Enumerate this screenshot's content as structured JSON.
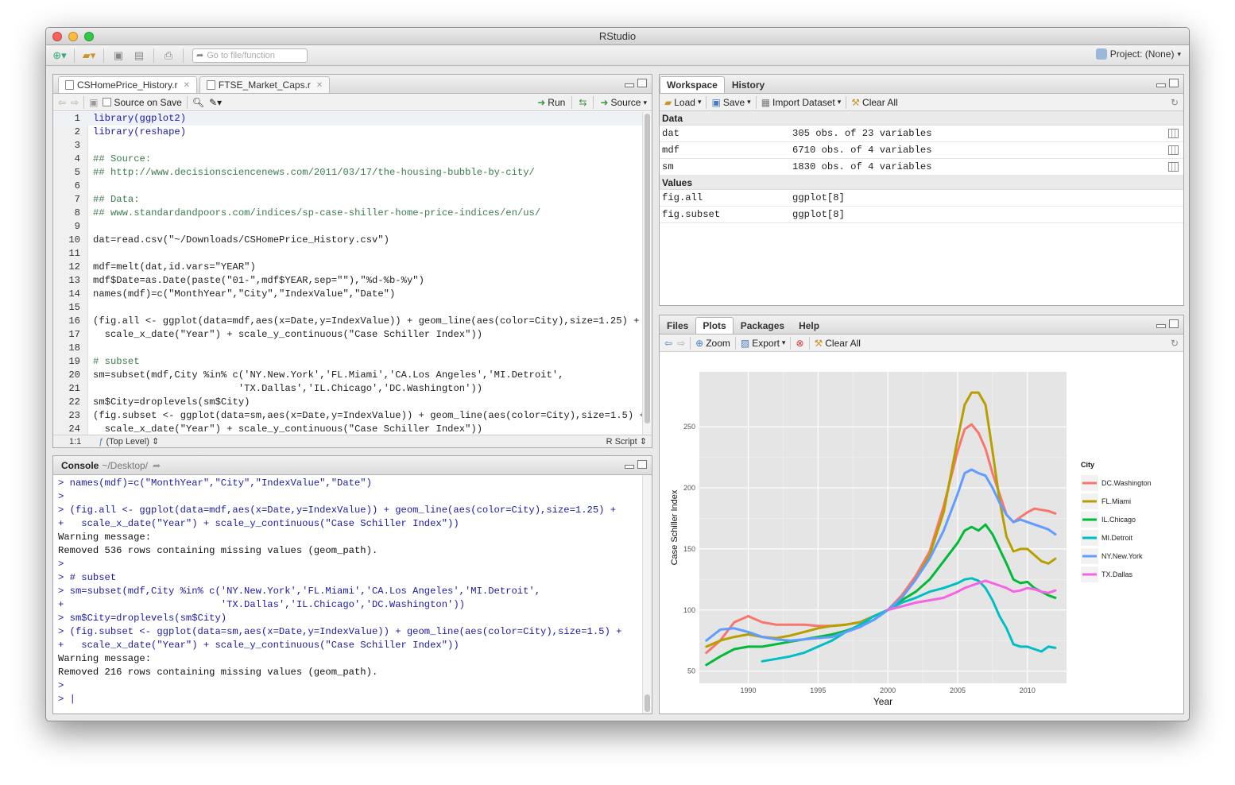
{
  "app": {
    "title": "RStudio",
    "goto_placeholder": "Go to file/function",
    "project": "Project: (None)"
  },
  "editor": {
    "tabs": [
      {
        "label": "CSHomePrice_History.r"
      },
      {
        "label": "FTSE_Market_Caps.r"
      }
    ],
    "source_on_save": "Source on Save",
    "run": "Run",
    "source": "Source",
    "lines": [
      {
        "n": "1",
        "t": "library(ggplot2)",
        "c": "kw"
      },
      {
        "n": "2",
        "t": "library(reshape)",
        "c": "kw"
      },
      {
        "n": "3",
        "t": "",
        "c": ""
      },
      {
        "n": "4",
        "t": "## Source:",
        "c": "cm"
      },
      {
        "n": "5",
        "t": "## http://www.decisionsciencenews.com/2011/03/17/the-housing-bubble-by-city/",
        "c": "cm"
      },
      {
        "n": "6",
        "t": "",
        "c": ""
      },
      {
        "n": "7",
        "t": "## Data:",
        "c": "cm"
      },
      {
        "n": "8",
        "t": "## www.standardandpoors.com/indices/sp-case-shiller-home-price-indices/en/us/",
        "c": "cm"
      },
      {
        "n": "9",
        "t": "",
        "c": ""
      },
      {
        "n": "10",
        "t": "dat=read.csv(\"~/Downloads/CSHomePrice_History.csv\")",
        "c": ""
      },
      {
        "n": "11",
        "t": "",
        "c": ""
      },
      {
        "n": "12",
        "t": "mdf=melt(dat,id.vars=\"YEAR\")",
        "c": ""
      },
      {
        "n": "13",
        "t": "mdf$Date=as.Date(paste(\"01-\",mdf$YEAR,sep=\"\"),\"%d-%b-%y\")",
        "c": ""
      },
      {
        "n": "14",
        "t": "names(mdf)=c(\"MonthYear\",\"City\",\"IndexValue\",\"Date\")",
        "c": ""
      },
      {
        "n": "15",
        "t": "",
        "c": ""
      },
      {
        "n": "16",
        "t": "(fig.all <- ggplot(data=mdf,aes(x=Date,y=IndexValue)) + geom_line(aes(color=City),size=1.25) +",
        "c": ""
      },
      {
        "n": "17",
        "t": "  scale_x_date(\"Year\") + scale_y_continuous(\"Case Schiller Index\"))",
        "c": ""
      },
      {
        "n": "18",
        "t": "",
        "c": ""
      },
      {
        "n": "19",
        "t": "# subset",
        "c": "cm"
      },
      {
        "n": "20",
        "t": "sm=subset(mdf,City %in% c('NY.New.York','FL.Miami','CA.Los Angeles','MI.Detroit',",
        "c": ""
      },
      {
        "n": "21",
        "t": "                         'TX.Dallas','IL.Chicago','DC.Washington'))",
        "c": ""
      },
      {
        "n": "22",
        "t": "sm$City=droplevels(sm$City)",
        "c": ""
      },
      {
        "n": "23",
        "t": "(fig.subset <- ggplot(data=sm,aes(x=Date,y=IndexValue)) + geom_line(aes(color=City),size=1.5) +",
        "c": ""
      },
      {
        "n": "24",
        "t": "  scale_x_date(\"Year\") + scale_y_continuous(\"Case Schiller Index\"))",
        "c": ""
      }
    ],
    "status_pos": "1:1",
    "status_scope": "(Top Level)",
    "status_type": "R Script"
  },
  "console": {
    "title": "Console",
    "path": "~/Desktop/",
    "lines": [
      {
        "t": "> names(mdf)=c(\"MonthYear\",\"City\",\"IndexValue\",\"Date\")",
        "c": "in"
      },
      {
        "t": ">",
        "c": "in"
      },
      {
        "t": "> (fig.all <- ggplot(data=mdf,aes(x=Date,y=IndexValue)) + geom_line(aes(color=City),size=1.25) +",
        "c": "in"
      },
      {
        "t": "+   scale_x_date(\"Year\") + scale_y_continuous(\"Case Schiller Index\"))",
        "c": "in"
      },
      {
        "t": "Warning message:",
        "c": "out"
      },
      {
        "t": "Removed 536 rows containing missing values (geom_path).",
        "c": "out"
      },
      {
        "t": ">",
        "c": "in"
      },
      {
        "t": "> # subset",
        "c": "in"
      },
      {
        "t": "> sm=subset(mdf,City %in% c('NY.New.York','FL.Miami','CA.Los Angeles','MI.Detroit',",
        "c": "in"
      },
      {
        "t": "+                           'TX.Dallas','IL.Chicago','DC.Washington'))",
        "c": "in"
      },
      {
        "t": "> sm$City=droplevels(sm$City)",
        "c": "in"
      },
      {
        "t": "> (fig.subset <- ggplot(data=sm,aes(x=Date,y=IndexValue)) + geom_line(aes(color=City),size=1.5) +",
        "c": "in"
      },
      {
        "t": "+   scale_x_date(\"Year\") + scale_y_continuous(\"Case Schiller Index\"))",
        "c": "in"
      },
      {
        "t": "Warning message:",
        "c": "out"
      },
      {
        "t": "Removed 216 rows containing missing values (geom_path).",
        "c": "out"
      },
      {
        "t": ">",
        "c": "in"
      },
      {
        "t": "> |",
        "c": "in"
      }
    ]
  },
  "workspace": {
    "tabs": [
      {
        "label": "Workspace"
      },
      {
        "label": "History"
      }
    ],
    "load": "Load",
    "save": "Save",
    "import": "Import Dataset",
    "clear": "Clear All",
    "data_header": "Data",
    "data": [
      {
        "name": "dat",
        "value": "305 obs. of 23 variables"
      },
      {
        "name": "mdf",
        "value": "6710 obs. of 4 variables"
      },
      {
        "name": "sm",
        "value": "1830 obs. of 4 variables"
      }
    ],
    "values_header": "Values",
    "values": [
      {
        "name": "fig.all",
        "value": "ggplot[8]"
      },
      {
        "name": "fig.subset",
        "value": "ggplot[8]"
      }
    ]
  },
  "files": {
    "tabs": [
      {
        "label": "Files"
      },
      {
        "label": "Plots"
      },
      {
        "label": "Packages"
      },
      {
        "label": "Help"
      }
    ],
    "zoom": "Zoom",
    "export": "Export",
    "clear": "Clear All"
  },
  "chart_data": {
    "type": "line",
    "title": "",
    "xlabel": "Year",
    "ylabel": "Case Schiller Index",
    "xlim": [
      1986.5,
      2012.8
    ],
    "ylim": [
      40,
      295
    ],
    "xticks": [
      "1990",
      "1995",
      "2000",
      "2005",
      "2010"
    ],
    "xtick_values": [
      1990,
      1995,
      2000,
      2005,
      2010
    ],
    "yticks": [
      "50",
      "100",
      "150",
      "200",
      "250"
    ],
    "ytick_values": [
      50,
      100,
      150,
      200,
      250
    ],
    "legend_title": "City",
    "legend_position": "right",
    "grid": true,
    "series": [
      {
        "name": "DC.Washington",
        "color": "#f8766d",
        "x": [
          1987,
          1988,
          1989,
          1990,
          1991,
          1992,
          1993,
          1994,
          1995,
          1996,
          1997,
          1998,
          1999,
          2000,
          2001,
          2002,
          2003,
          2004,
          2005,
          2005.5,
          2006,
          2006.5,
          2007,
          2007.5,
          2008,
          2008.5,
          2009,
          2009.5,
          2010,
          2010.5,
          2011,
          2011.5,
          2012
        ],
        "y": [
          65,
          75,
          90,
          95,
          90,
          88,
          88,
          88,
          87,
          87,
          88,
          90,
          95,
          100,
          112,
          128,
          148,
          185,
          230,
          248,
          252,
          245,
          232,
          212,
          195,
          178,
          172,
          176,
          180,
          183,
          182,
          181,
          179
        ]
      },
      {
        "name": "FL.Miami",
        "color": "#b79f00",
        "x": [
          1987,
          1988,
          1989,
          1990,
          1991,
          1992,
          1993,
          1994,
          1995,
          1996,
          1997,
          1998,
          1999,
          2000,
          2001,
          2002,
          2003,
          2004,
          2005,
          2005.5,
          2006,
          2006.5,
          2007,
          2007.5,
          2008,
          2008.5,
          2009,
          2009.5,
          2010,
          2010.5,
          2011,
          2011.5,
          2012
        ],
        "y": [
          70,
          75,
          78,
          80,
          78,
          77,
          79,
          82,
          85,
          87,
          88,
          90,
          95,
          100,
          110,
          125,
          145,
          180,
          240,
          268,
          278,
          278,
          268,
          230,
          190,
          160,
          148,
          150,
          150,
          145,
          140,
          138,
          142
        ]
      },
      {
        "name": "IL.Chicago",
        "color": "#00ba38",
        "x": [
          1987,
          1988,
          1989,
          1990,
          1991,
          1992,
          1993,
          1994,
          1995,
          1996,
          1997,
          1998,
          1999,
          2000,
          2001,
          2002,
          2003,
          2004,
          2005,
          2005.5,
          2006,
          2006.5,
          2007,
          2007.5,
          2008,
          2008.5,
          2009,
          2009.5,
          2010,
          2010.5,
          2011,
          2011.5,
          2012
        ],
        "y": [
          55,
          62,
          68,
          70,
          70,
          72,
          74,
          76,
          78,
          80,
          83,
          87,
          92,
          100,
          108,
          115,
          125,
          140,
          155,
          165,
          168,
          165,
          170,
          162,
          150,
          138,
          125,
          122,
          123,
          118,
          115,
          112,
          110
        ]
      },
      {
        "name": "MI.Detroit",
        "color": "#00bfc4",
        "x": [
          1991,
          1992,
          1993,
          1994,
          1995,
          1996,
          1997,
          1998,
          1999,
          2000,
          2001,
          2002,
          2003,
          2004,
          2005,
          2005.5,
          2006,
          2006.5,
          2007,
          2007.5,
          2008,
          2008.5,
          2009,
          2009.5,
          2010,
          2010.5,
          2011,
          2011.5,
          2012
        ],
        "y": [
          58,
          60,
          62,
          65,
          70,
          75,
          82,
          88,
          95,
          100,
          106,
          110,
          115,
          118,
          122,
          125,
          126,
          124,
          118,
          108,
          95,
          85,
          72,
          70,
          70,
          68,
          66,
          70,
          69
        ]
      },
      {
        "name": "NY.New.York",
        "color": "#619cff",
        "x": [
          1987,
          1988,
          1989,
          1990,
          1991,
          1992,
          1993,
          1994,
          1995,
          1996,
          1997,
          1998,
          1999,
          2000,
          2001,
          2002,
          2003,
          2004,
          2005,
          2005.5,
          2006,
          2006.5,
          2007,
          2007.5,
          2008,
          2008.5,
          2009,
          2009.5,
          2010,
          2010.5,
          2011,
          2011.5,
          2012
        ],
        "y": [
          75,
          84,
          85,
          82,
          78,
          76,
          75,
          76,
          77,
          78,
          82,
          86,
          92,
          100,
          110,
          125,
          142,
          165,
          195,
          212,
          215,
          212,
          210,
          200,
          188,
          178,
          172,
          174,
          172,
          170,
          168,
          166,
          162
        ]
      },
      {
        "name": "TX.Dallas",
        "color": "#f564e3",
        "x": [
          2000,
          2001,
          2002,
          2003,
          2004,
          2005,
          2005.5,
          2006,
          2006.5,
          2007,
          2007.5,
          2008,
          2008.5,
          2009,
          2009.5,
          2010,
          2010.5,
          2011,
          2011.5,
          2012
        ],
        "y": [
          100,
          103,
          106,
          108,
          110,
          115,
          118,
          120,
          122,
          124,
          122,
          120,
          118,
          115,
          116,
          118,
          117,
          115,
          114,
          116
        ]
      }
    ]
  }
}
